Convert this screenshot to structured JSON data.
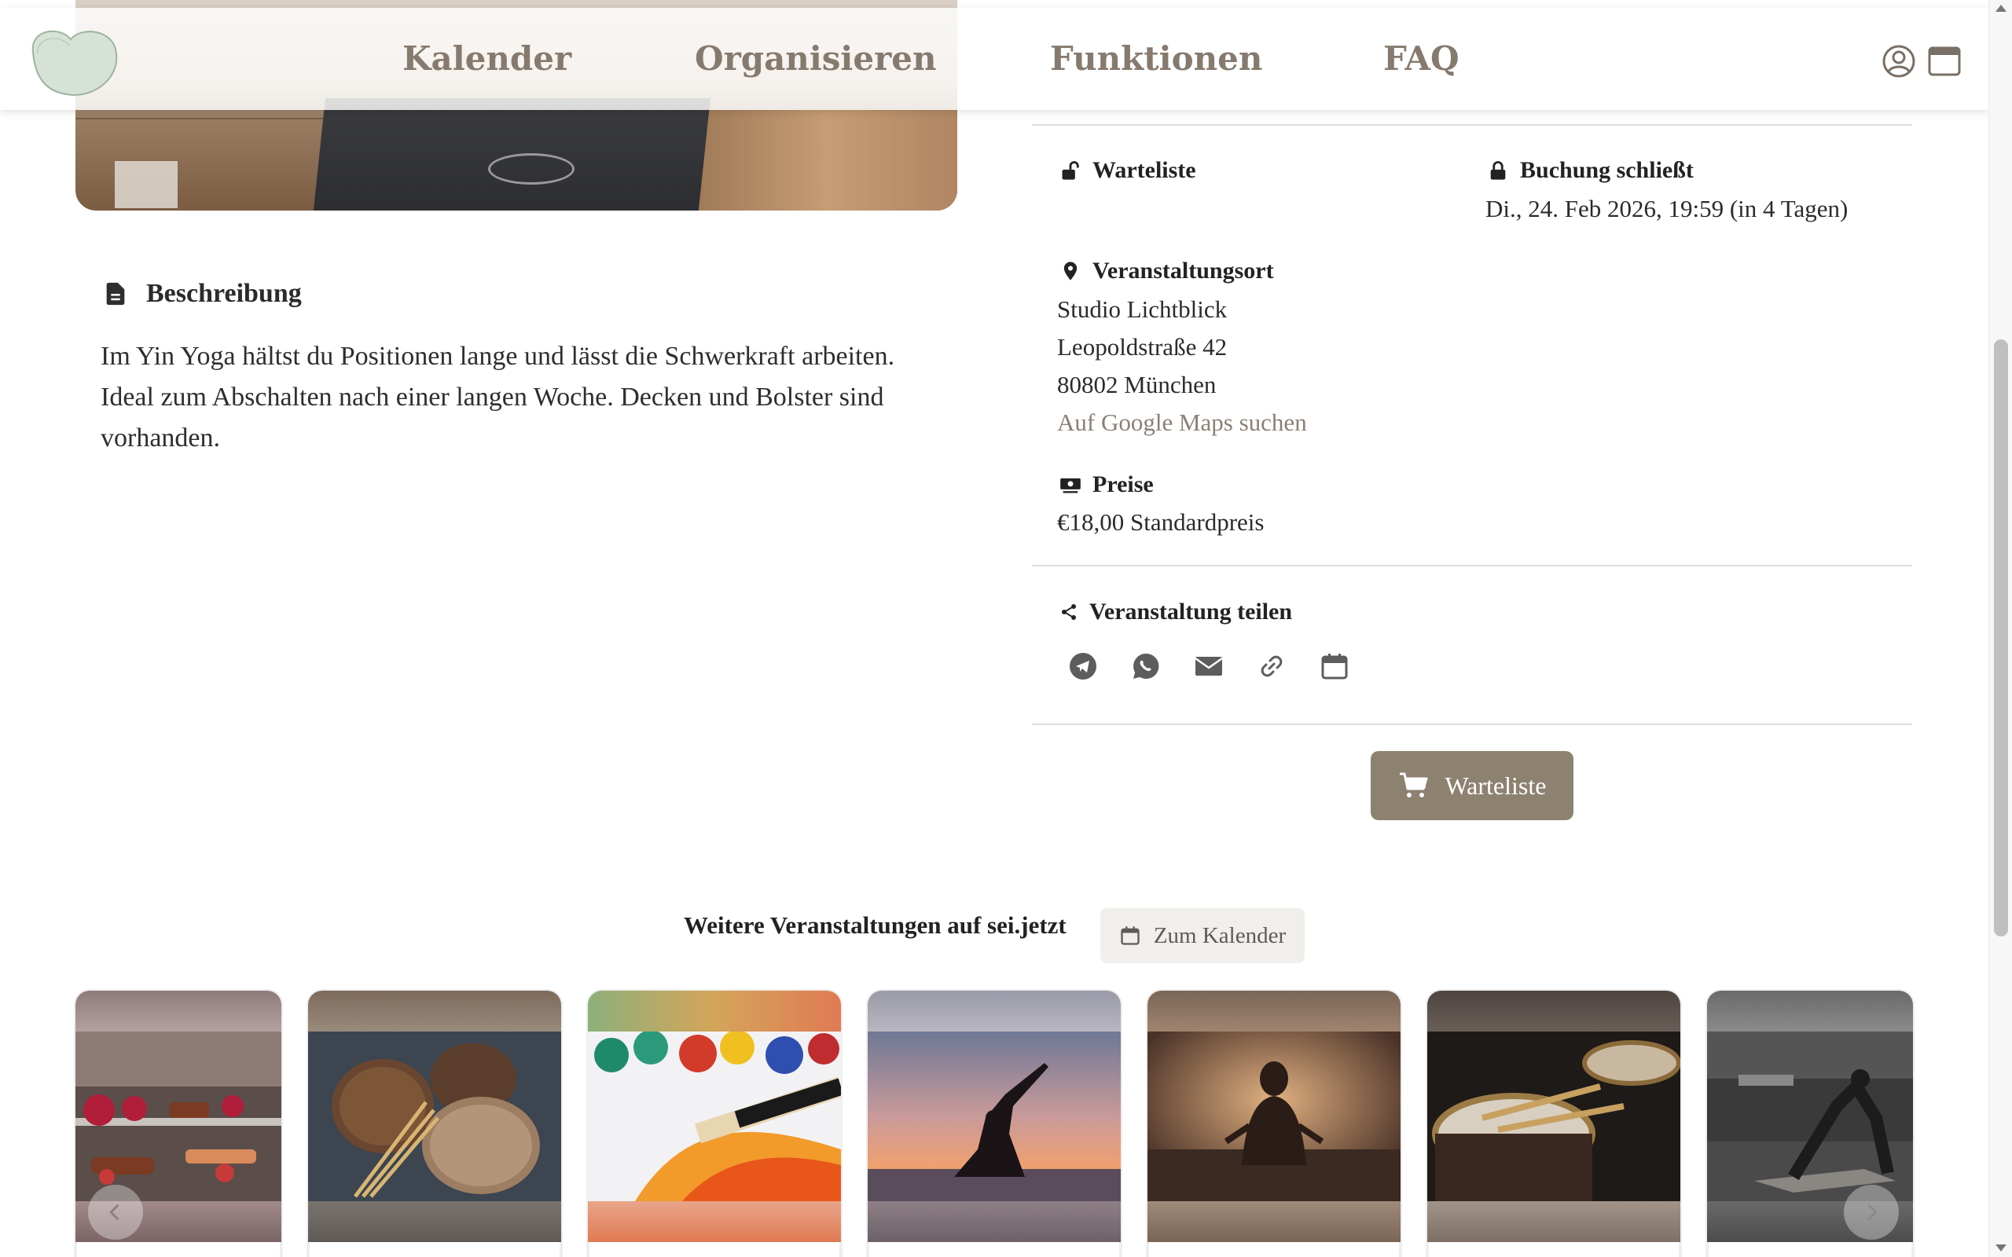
{
  "nav": {
    "items": [
      "Kalender",
      "Organisieren",
      "Funktionen",
      "FAQ"
    ]
  },
  "icons": {
    "account": "user-circle-icon",
    "calendar_window": "browser-window-icon"
  },
  "description": {
    "heading": "Beschreibung",
    "text": "Im Yin Yoga hältst du Positionen lange und lässt die Schwerkraft arbeiten. Ideal zum Abschalten nach einer langen Woche. Decken und Bolster sind vorhanden."
  },
  "info": {
    "waitlist_label": "Warteliste",
    "booking_closes_label": "Buchung schließt",
    "booking_closes_value": "Di., 24. Feb 2026, 19:59 (in 4 Tagen)",
    "location_label": "Veranstaltungsort",
    "location_name": "Studio Lichtblick",
    "location_street": "Leopoldstraße 42",
    "location_city": "80802 München",
    "maps_link": "Auf Google Maps suchen",
    "prices_label": "Preise",
    "price_value": "€18,00 Standardpreis"
  },
  "share": {
    "label": "Veranstaltung teilen",
    "icons": [
      "telegram-icon",
      "whatsapp-icon",
      "email-icon",
      "link-icon",
      "calendar-icon"
    ]
  },
  "cta": {
    "label": "Warteliste"
  },
  "more_events": {
    "title": "Weitere Veranstaltungen auf sei.jetzt",
    "calendar_button": "Zum Kalender",
    "cards": [
      "Pastries",
      "Bread",
      "Painting",
      "Yoga sunset",
      "Meditation",
      "Drums",
      "Yoga studio"
    ]
  },
  "colors": {
    "accent": "#8d8170",
    "nav_text": "#867a6e",
    "link": "#8a8074"
  }
}
